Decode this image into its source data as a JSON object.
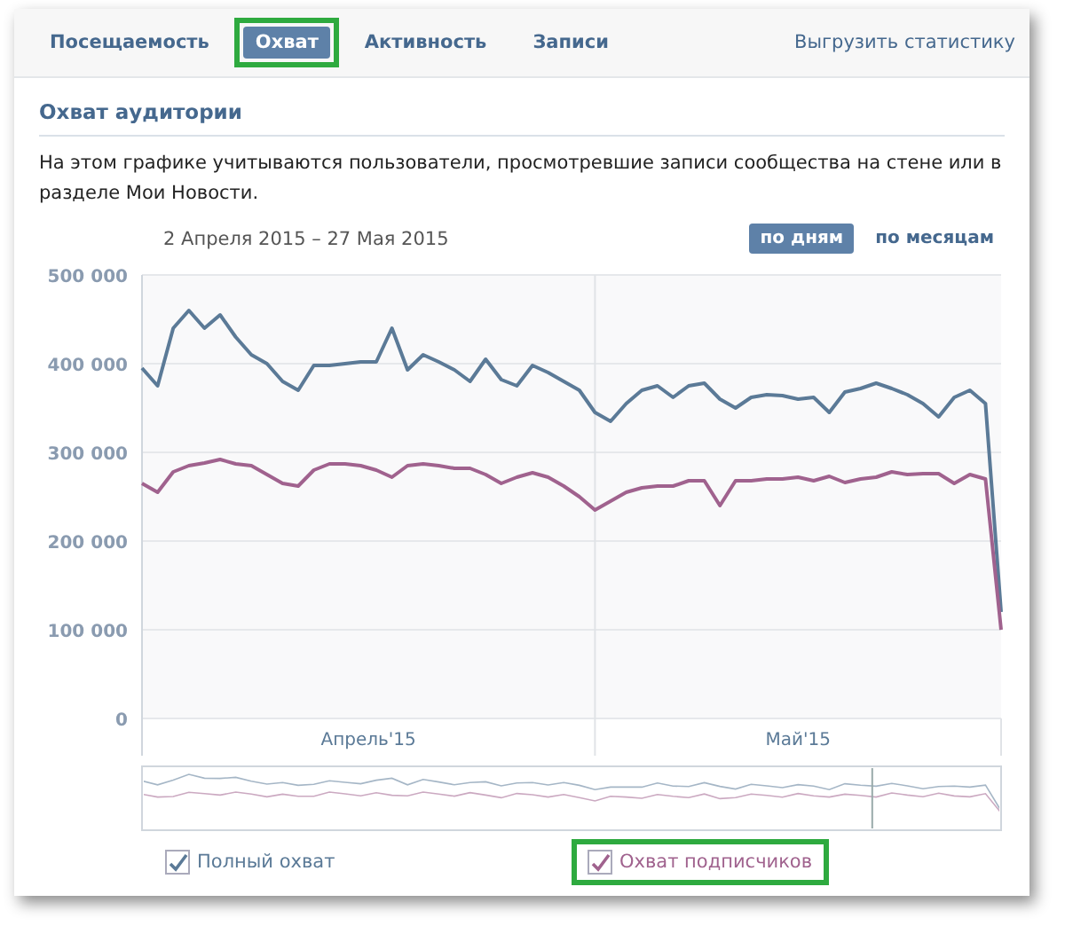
{
  "tabs": [
    {
      "label": "Посещаемость",
      "selected": false,
      "highlighted": false
    },
    {
      "label": "Охват",
      "selected": true,
      "highlighted": true
    },
    {
      "label": "Активность",
      "selected": false,
      "highlighted": false
    },
    {
      "label": "Записи",
      "selected": false,
      "highlighted": false
    }
  ],
  "export_link": "Выгрузить статистику",
  "section": {
    "title": "Охват аудитории",
    "description": "На этом графике учитываются пользователи, просмотревшие записи сообщества на стене или в разделе Мои Новости."
  },
  "date_range": "2 Апреля 2015 – 27 Мая 2015",
  "period_toggle": [
    {
      "label": "по дням",
      "selected": true
    },
    {
      "label": "по месяцам",
      "selected": false
    }
  ],
  "chart": {
    "month_labels": [
      "Апрель'15",
      "Май'15"
    ],
    "chart_data": {
      "type": "line",
      "grid": true,
      "ylim": [
        0,
        500000
      ],
      "yticks": [
        {
          "value": 0,
          "label": "0"
        },
        {
          "value": 100000,
          "label": "100 000"
        },
        {
          "value": 200000,
          "label": "200 000"
        },
        {
          "value": 300000,
          "label": "300 000"
        },
        {
          "value": 400000,
          "label": "400 000"
        },
        {
          "value": 500000,
          "label": "500 000"
        }
      ],
      "series": [
        {
          "name": "Полный охват",
          "color": "#5b7a97",
          "values": [
            395000,
            375000,
            440000,
            460000,
            440000,
            455000,
            430000,
            410000,
            400000,
            380000,
            370000,
            398000,
            398000,
            400000,
            402000,
            402000,
            440000,
            393000,
            410000,
            402000,
            393000,
            380000,
            405000,
            382000,
            375000,
            398000,
            390000,
            380000,
            370000,
            345000,
            335000,
            355000,
            370000,
            375000,
            362000,
            375000,
            378000,
            360000,
            350000,
            362000,
            365000,
            364000,
            360000,
            362000,
            345000,
            368000,
            372000,
            378000,
            372000,
            365000,
            355000,
            340000,
            362000,
            370000,
            355000,
            120000
          ]
        },
        {
          "name": "Охват подписчиков",
          "color": "#a0628e",
          "values": [
            265000,
            255000,
            278000,
            285000,
            288000,
            292000,
            287000,
            285000,
            275000,
            265000,
            262000,
            280000,
            287000,
            287000,
            285000,
            280000,
            272000,
            285000,
            287000,
            285000,
            282000,
            282000,
            275000,
            265000,
            272000,
            277000,
            272000,
            262000,
            250000,
            235000,
            245000,
            255000,
            260000,
            262000,
            262000,
            268000,
            268000,
            240000,
            268000,
            268000,
            270000,
            270000,
            272000,
            268000,
            273000,
            266000,
            270000,
            272000,
            278000,
            275000,
            276000,
            276000,
            265000,
            275000,
            270000,
            100000
          ]
        }
      ]
    }
  },
  "legend": [
    {
      "checked": true,
      "highlighted": false
    },
    {
      "checked": true,
      "highlighted": true
    }
  ]
}
